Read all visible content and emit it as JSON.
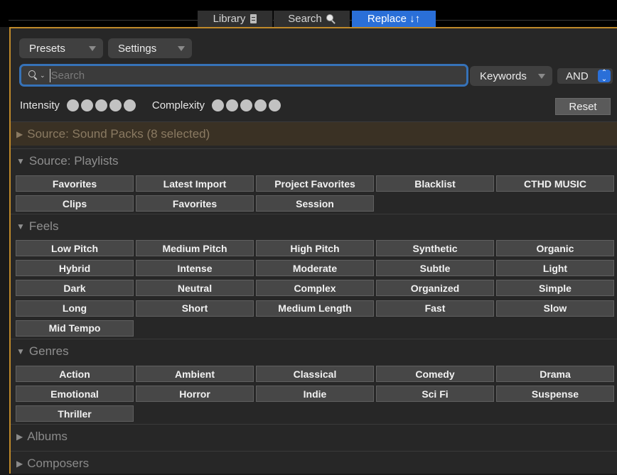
{
  "tabs": [
    {
      "label": "Library",
      "icon": "library-icon"
    },
    {
      "label": "Search",
      "icon": "magnifier-icon"
    },
    {
      "label": "Replace ↓↑",
      "active": true
    }
  ],
  "toolbar": {
    "presets": "Presets",
    "settings": "Settings"
  },
  "search": {
    "placeholder": "Search",
    "value": ""
  },
  "keywords": "Keywords",
  "logic": "AND",
  "intensity_label": "Intensity",
  "complexity_label": "Complexity",
  "reset": "Reset",
  "sections": {
    "sound_packs": "Source: Sound Packs (8 selected)",
    "playlists": "Source: Playlists",
    "feels": "Feels",
    "genres": "Genres",
    "albums": "Albums",
    "composers": "Composers"
  },
  "playlists": [
    "Favorites",
    "Latest Import",
    "Project Favorites",
    "Blacklist",
    "CTHD MUSIC",
    "Clips",
    "Favorites",
    "Session"
  ],
  "feels": [
    "Low Pitch",
    "Medium Pitch",
    "High Pitch",
    "Synthetic",
    "Organic",
    "Hybrid",
    "Intense",
    "Moderate",
    "Subtle",
    "Light",
    "Dark",
    "Neutral",
    "Complex",
    "Organized",
    "Simple",
    "Long",
    "Short",
    "Medium Length",
    "Fast",
    "Slow",
    "Mid Tempo"
  ],
  "genres": [
    "Action",
    "Ambient",
    "Classical",
    "Comedy",
    "Drama",
    "Emotional",
    "Horror",
    "Indie",
    "Sci Fi",
    "Suspense",
    "Thriller"
  ],
  "colors": {
    "accent": "#2a6fd8",
    "panel_border": "#c08a2a",
    "focus": "#3672b8"
  }
}
